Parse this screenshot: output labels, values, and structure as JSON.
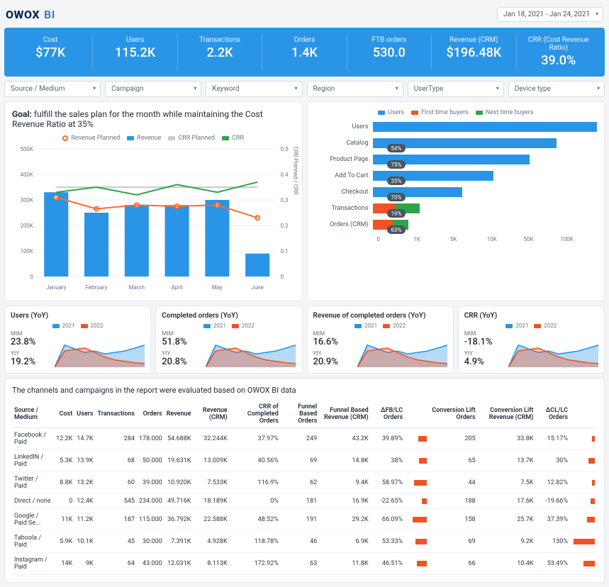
{
  "logo": {
    "brand": "OWOX",
    "sub": "BI"
  },
  "date_range": {
    "text": "Jan 18, 2021 - Jan 24, 2021"
  },
  "kpis": [
    {
      "label": "Cost",
      "value": "$77K"
    },
    {
      "label": "Users",
      "value": "115.2K"
    },
    {
      "label": "Transactions",
      "value": "2.2K"
    },
    {
      "label": "Orders",
      "value": "1.4K"
    },
    {
      "label": "FTB orders",
      "value": "530.0"
    },
    {
      "label": "Revenue (CRM)",
      "value": "$196.48K"
    },
    {
      "label": "CRR (Cost Revenue Ratio)",
      "value": "39.0%"
    }
  ],
  "filters": [
    "Source / Medium",
    "Campaign",
    "Keyword",
    "Region",
    "UserType",
    "Device type"
  ],
  "goal": {
    "title_bold": "Goal:",
    "title_rest": " fulfill the sales plan for the month while maintaining the Cost Revenue Ratio at 35%",
    "legend": [
      {
        "label": "Revenue Planned",
        "color": "#ff6a2b",
        "type": "dot"
      },
      {
        "label": "Revenue",
        "color": "#2a95e6",
        "type": "sw"
      },
      {
        "label": "CRR Planned",
        "color": "#c6ccd2",
        "type": "sw"
      },
      {
        "label": "CRR",
        "color": "#2fa44a",
        "type": "sw"
      }
    ],
    "y_right_label": "CRR Planned / CRR"
  },
  "chart_data": [
    {
      "type": "bar-line-combo",
      "title": "Revenue vs Plan with CRR",
      "categories": [
        "January",
        "February",
        "March",
        "April",
        "May",
        "June"
      ],
      "left_axis": {
        "label": "",
        "ticks": [
          "0",
          "100K",
          "200K",
          "300K",
          "400K",
          "500K"
        ],
        "max": 500
      },
      "right_axis": {
        "label": "CRR Planned / CRR",
        "ticks": [
          "0",
          "0.1",
          "0.2",
          "0.3",
          "0.4",
          "0.5"
        ],
        "max": 0.5
      },
      "series": [
        {
          "name": "Revenue",
          "kind": "bar",
          "color": "#2a95e6",
          "values": [
            330,
            250,
            280,
            280,
            300,
            90
          ]
        },
        {
          "name": "Revenue Planned",
          "kind": "line",
          "color": "#ff6a2b",
          "values": [
            310,
            265,
            280,
            275,
            280,
            230
          ]
        },
        {
          "name": "CRR Planned",
          "kind": "line",
          "color": "#c6ccd2",
          "values": [
            0.35,
            0.35,
            0.35,
            0.35,
            0.35,
            0.35
          ]
        },
        {
          "name": "CRR",
          "kind": "line",
          "color": "#2fa44a",
          "values": [
            0.33,
            0.35,
            0.32,
            0.36,
            0.33,
            0.37
          ]
        }
      ]
    },
    {
      "type": "funnel-bar",
      "title": "User funnel",
      "legend": [
        {
          "label": "Users",
          "color": "#2a95e6"
        },
        {
          "label": "First time buyers",
          "color": "#f05423"
        },
        {
          "label": "Next time buyers",
          "color": "#2fa44a"
        }
      ],
      "stages": [
        {
          "label": "Users",
          "segments": [
            {
              "w": 100,
              "c": "#2a95e6"
            }
          ],
          "pct": null
        },
        {
          "label": "Catalog",
          "segments": [
            {
              "w": 82,
              "c": "#2a95e6"
            }
          ],
          "pct": "54%"
        },
        {
          "label": "Product Page",
          "segments": [
            {
              "w": 70,
              "c": "#2a95e6"
            }
          ],
          "pct": "75%"
        },
        {
          "label": "Add To Cart",
          "segments": [
            {
              "w": 54,
              "c": "#2a95e6"
            }
          ],
          "pct": "35%"
        },
        {
          "label": "Checkout",
          "segments": [
            {
              "w": 40,
              "c": "#2a95e6"
            }
          ],
          "pct": "70%"
        },
        {
          "label": "Transactions",
          "segments": [
            {
              "w": 10,
              "c": "#f05423"
            },
            {
              "w": 11,
              "c": "#2fa44a"
            }
          ],
          "pct": "19%"
        },
        {
          "label": "Orders (CRM)",
          "segments": [
            {
              "w": 9,
              "c": "#f05423"
            },
            {
              "w": 7,
              "c": "#2fa44a"
            }
          ],
          "pct": "63%"
        }
      ],
      "x_ticks": [
        "0",
        "1K",
        "5K",
        "10K",
        "50K",
        "100K"
      ]
    }
  ],
  "yoy": {
    "legend": [
      "2021",
      "2022"
    ],
    "cards": [
      {
        "title": "Users (YoY)",
        "mtm": "23.8%",
        "yty": "19.2%",
        "spark": "a"
      },
      {
        "title": "Completed orders (YoY)",
        "mtm": "51.8%",
        "yty": "20.8%",
        "spark": "b"
      },
      {
        "title": "Revenue of completed orders (YoY)",
        "mtm": "16.6%",
        "yty": "20.9%",
        "spark": "c"
      },
      {
        "title": "CRR (YoY)",
        "mtm": "-18.1%",
        "yty": "4.9%",
        "spark": "d"
      }
    ],
    "mtm_label": "MtM",
    "yty_label": "YtY"
  },
  "table": {
    "heading": "The channels and campaigns in the report were evaluated based on OWOX BI data",
    "columns": [
      "Source / Medium",
      "Cost",
      "Users",
      "Transactions",
      "Orders",
      "Revenue",
      "Revenue (CRM)",
      "CRR of Completed Orders",
      "Funnel Based Orders",
      "Funnel Based Revenue (CRM)",
      "ΔFB/LC Orders",
      "",
      "Conversion Lift Orders",
      "Conversion Lift Revenue (CRM)",
      "ΔCL/LC Orders",
      ""
    ],
    "rows": [
      {
        "sm": "Facebook / Paid",
        "cost": "12.2K",
        "users": "14.7K",
        "tx": "284",
        "orders": "178.000",
        "rev": "54.688K",
        "revcrm": "32.244K",
        "crr": "37.97%",
        "fbo": "249",
        "fbr": "43.2K",
        "dfb": "39.89%",
        "dfb_bar": 40,
        "clo": "205",
        "clr": "33.8K",
        "dcl": "15.17%",
        "dcl_bar": 15
      },
      {
        "sm": "LinkedIN / Paid",
        "cost": "5.3K",
        "users": "13.9K",
        "tx": "68",
        "orders": "50.000",
        "rev": "19.631K",
        "revcrm": "13.009K",
        "crr": "40.56%",
        "fbo": "69",
        "fbr": "14.8K",
        "dfb": "38%",
        "dfb_bar": 38,
        "clo": "65",
        "clr": "13.7K",
        "dcl": "30%",
        "dcl_bar": 30
      },
      {
        "sm": "Twitter / Paid",
        "cost": "8.8K",
        "users": "13.2K",
        "tx": "60",
        "orders": "39.000",
        "rev": "10.920K",
        "revcrm": "7.533K",
        "crr": "116.9%",
        "fbo": "62",
        "fbr": "9.4K",
        "dfb": "58.97%",
        "dfb_bar": 59,
        "clo": "44",
        "clr": "7.5K",
        "dcl": "12.82%",
        "dcl_bar": 13
      },
      {
        "sm": "Direct / none",
        "cost": "0",
        "users": "12.4K",
        "tx": "545",
        "orders": "234.000",
        "rev": "49.716K",
        "revcrm": "18.189K",
        "crr": "0%",
        "fbo": "181",
        "fbr": "16.9K",
        "dfb": "-22.65%",
        "dfb_bar": 23,
        "clo": "188",
        "clr": "17.6K",
        "dcl": "-19.66%",
        "dcl_bar": 20
      },
      {
        "sm": "Google / Paid Se...",
        "cost": "11K",
        "users": "11.2K",
        "tx": "187",
        "orders": "115.000",
        "rev": "36.792K",
        "revcrm": "22.588K",
        "crr": "48.52%",
        "fbo": "191",
        "fbr": "29.2K",
        "dfb": "66.09%",
        "dfb_bar": 66,
        "clo": "158",
        "clr": "25.7K",
        "dcl": "37.39%",
        "dcl_bar": 37
      },
      {
        "sm": "Taboola / Paid",
        "cost": "5.9K",
        "users": "10.1K",
        "tx": "45",
        "orders": "30.000",
        "rev": "7.391K",
        "revcrm": "4.928K",
        "crr": "118.78%",
        "fbo": "46",
        "fbr": "6.9K",
        "dfb": "53.33%",
        "dfb_bar": 53,
        "clo": "69",
        "clr": "9.2K",
        "dcl": "130%",
        "dcl_bar": 100
      },
      {
        "sm": "Instagram / Paid",
        "cost": "14K",
        "users": "9K",
        "tx": "64",
        "orders": "43.000",
        "rev": "12.031K",
        "revcrm": "8.113K",
        "crr": "172.92%",
        "fbo": "63",
        "fbr": "11.8K",
        "dfb": "46.51%",
        "dfb_bar": 47,
        "clo": "66",
        "clr": "10.4K",
        "dcl": "53.49%",
        "dcl_bar": 53
      }
    ]
  }
}
